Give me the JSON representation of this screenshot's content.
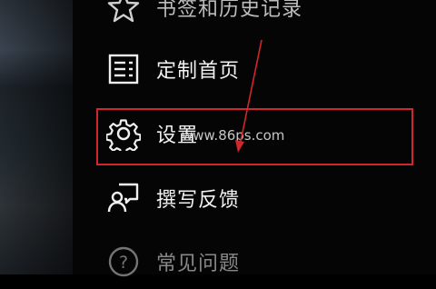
{
  "menu": {
    "items": [
      {
        "label": "书签和历史记录",
        "icon": "star-icon"
      },
      {
        "label": "定制首页",
        "icon": "list-icon"
      },
      {
        "label": "设置",
        "icon": "gear-icon"
      },
      {
        "label": "撰写反馈",
        "icon": "feedback-icon"
      },
      {
        "label": "常见问题",
        "icon": "help-icon"
      }
    ]
  },
  "watermark": "www.86ps.com",
  "highlight_color": "#d1262b"
}
